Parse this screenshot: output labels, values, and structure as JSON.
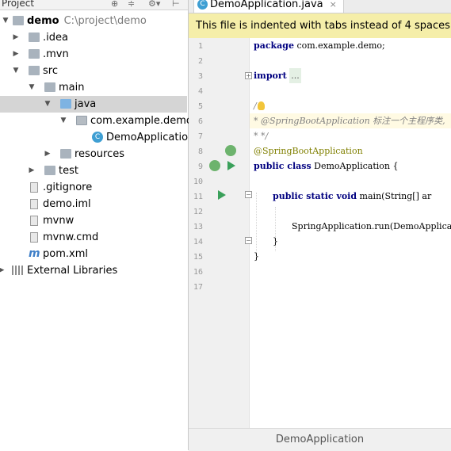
{
  "project_panel": {
    "title": "Project",
    "tree": [
      {
        "label": "demo",
        "path": "C:\\project\\demo"
      },
      {
        "label": ".idea"
      },
      {
        "label": ".mvn"
      },
      {
        "label": "src"
      },
      {
        "label": "main"
      },
      {
        "label": "java"
      },
      {
        "label": "com.example.demo"
      },
      {
        "label": "DemoApplication"
      },
      {
        "label": "resources"
      },
      {
        "label": "test"
      },
      {
        "label": ".gitignore"
      },
      {
        "label": "demo.iml"
      },
      {
        "label": "mvnw"
      },
      {
        "label": "mvnw.cmd"
      },
      {
        "label": "pom.xml"
      },
      {
        "label": "External Libraries"
      }
    ]
  },
  "editor": {
    "tab_label": "DemoApplication.java",
    "notice": "This file is indented with tabs instead of 4 spaces",
    "line_numbers": [
      "1",
      "2",
      "3",
      "4",
      "5",
      "6",
      "7",
      "8",
      "9",
      "10",
      "11",
      "12",
      "13",
      "14",
      "15",
      "16",
      "17"
    ],
    "code": {
      "l1_kw": "package",
      "l1_rest": " com.example.demo;",
      "l3_kw": "import",
      "l3_fold": "...",
      "l6": "/",
      "l7": "* @SpringBootApplication 标注一个主程序类,",
      "l8": "* */",
      "l9": "@SpringBootApplication",
      "l10_kw": "public class",
      "l10_rest": " DemoApplication {",
      "l12_kw": "public static void",
      "l12_rest": " main(String[] ar",
      "l14": "SpringApplication.run(DemoApplicat",
      "l15": "}",
      "l16": "}"
    },
    "breadcrumb": "DemoApplication"
  }
}
